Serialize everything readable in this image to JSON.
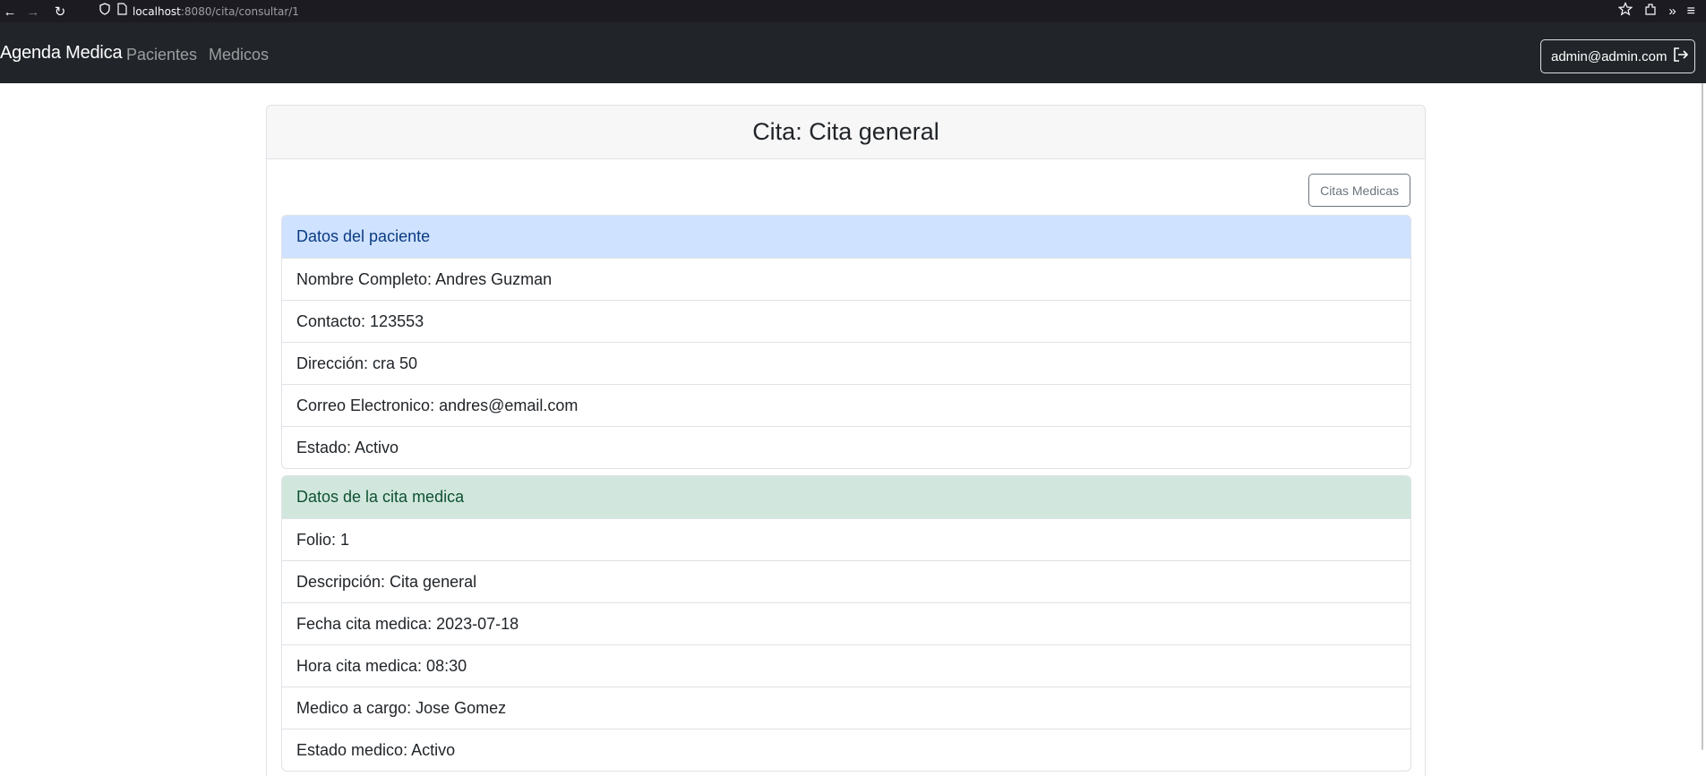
{
  "browser": {
    "url_host": "localhost",
    "url_path": ":8080/cita/consultar/1"
  },
  "navbar": {
    "brand": "Agenda Medica",
    "links": [
      "Pacientes",
      "Medicos"
    ],
    "user_email": "admin@admin.com"
  },
  "card": {
    "title": "Cita: Cita general",
    "back_button": "Citas Medicas"
  },
  "patient_section": {
    "heading": "Datos del paciente",
    "items": [
      "Nombre Completo: Andres Guzman",
      "Contacto: 123553",
      "Dirección: cra 50",
      "Correo Electronico: andres@email.com",
      "Estado: Activo"
    ]
  },
  "appointment_section": {
    "heading": "Datos de la cita medica",
    "items": [
      "Folio: 1",
      "Descripción: Cita general",
      "Fecha cita medica: 2023-07-18",
      "Hora cita medica: 08:30",
      "Medico a cargo: Jose Gomez",
      "Estado medico: Activo"
    ]
  },
  "colors": {
    "navbar_bg": "#212529",
    "primary_subtle": "#cfe2ff",
    "success_subtle": "#d1e7dd"
  }
}
